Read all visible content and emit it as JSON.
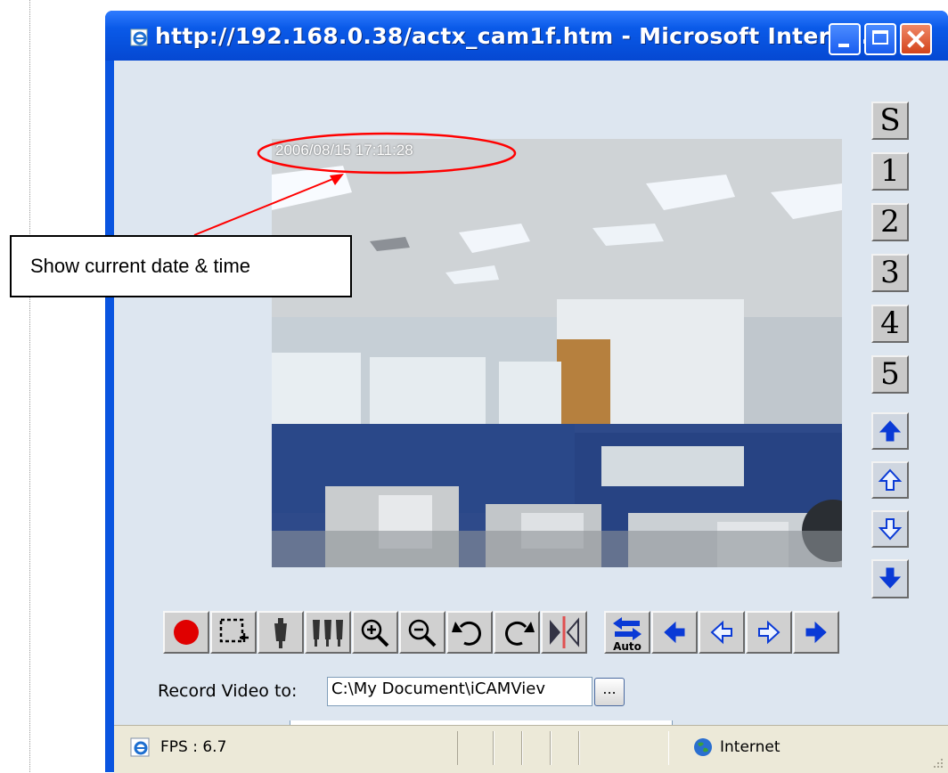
{
  "window": {
    "title": "http://192.168.0.38/actx_cam1f.htm - Microsoft Interne..."
  },
  "video": {
    "timestamp": "2006/08/15 17:11:28"
  },
  "channels": [
    "S",
    "1",
    "2",
    "3",
    "4",
    "5"
  ],
  "ptz_vertical": [
    {
      "name": "tilt-up-fast",
      "icon": "arrow-up-solid-icon"
    },
    {
      "name": "tilt-up",
      "icon": "arrow-up-outline-icon"
    },
    {
      "name": "tilt-down",
      "icon": "arrow-down-outline-icon"
    },
    {
      "name": "tilt-down-fast",
      "icon": "arrow-down-solid-icon"
    }
  ],
  "toolbar": [
    {
      "name": "record",
      "icon": "record-icon"
    },
    {
      "name": "select-region",
      "icon": "select-region-icon"
    },
    {
      "name": "focus-near",
      "icon": "focus-near-icon"
    },
    {
      "name": "focus-far",
      "icon": "focus-far-icon"
    },
    {
      "name": "zoom-in",
      "icon": "zoom-in-icon"
    },
    {
      "name": "zoom-out",
      "icon": "zoom-out-icon"
    },
    {
      "name": "rotate-left",
      "icon": "rotate-left-icon"
    },
    {
      "name": "rotate-right",
      "icon": "rotate-right-icon"
    },
    {
      "name": "mirror",
      "icon": "mirror-icon"
    },
    {
      "name": "auto-pan",
      "icon": "auto-pan-icon",
      "label": "Auto"
    },
    {
      "name": "pan-left-fast",
      "icon": "arrow-left-solid-icon"
    },
    {
      "name": "pan-left",
      "icon": "arrow-left-outline-icon"
    },
    {
      "name": "pan-right",
      "icon": "arrow-right-outline-icon"
    },
    {
      "name": "pan-right-fast",
      "icon": "arrow-right-solid-icon"
    }
  ],
  "record": {
    "label": "Record Video to:",
    "path": "C:\\My Document\\iCAMViev",
    "browse_label": "..."
  },
  "status": {
    "fps": "FPS : 6.7",
    "zone": "Internet"
  },
  "annotation": {
    "text": "Show current date & time"
  },
  "colors": {
    "titlebar": "#0a55e0",
    "client_bg": "#dde6f0",
    "arrow_blue": "#0a3ad6",
    "annotation_red": "#ff0000"
  }
}
